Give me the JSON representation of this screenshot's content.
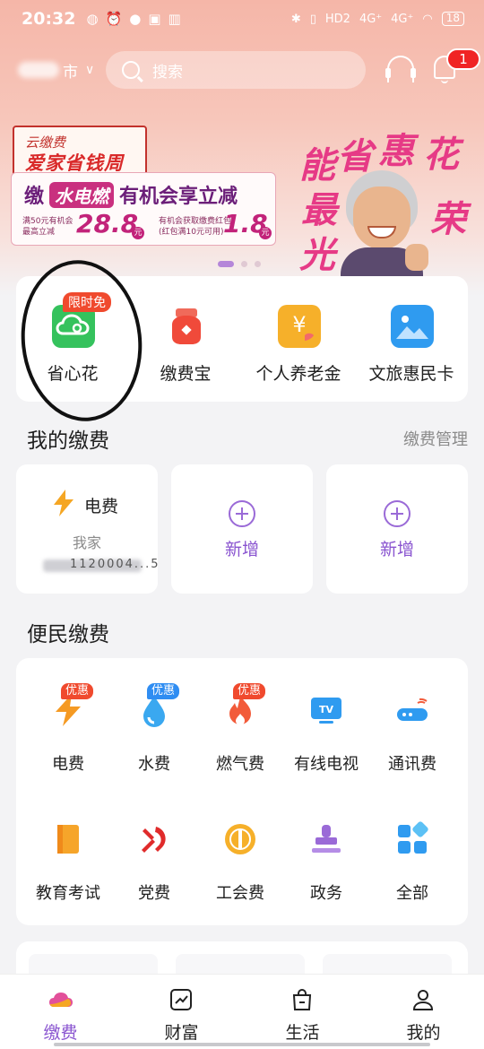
{
  "status_bar": {
    "time": "20:32",
    "network1": "HD2",
    "network2": "4G⁺",
    "network3": "4G⁺",
    "battery": "18"
  },
  "header": {
    "location_suffix": "市",
    "search_placeholder": "搜索",
    "notification_count": "1"
  },
  "banner": {
    "brand": "云缴费",
    "event_title": "爱家省钱周",
    "headline_prefix": "缴",
    "headline_pill": "水电燃",
    "headline_suffix": "有机会享立减",
    "left_small": "满50元有机会\n最高立减",
    "left_amount": "28.8",
    "unit": "元",
    "right_small": "有机会获取缴费红包\n(红包满10元可用)",
    "right_amount": "1.8",
    "slogan_chars": [
      "能",
      "省",
      "惠",
      "花",
      "最",
      "光",
      "荣"
    ]
  },
  "quick_actions": [
    {
      "label": "省心花",
      "badge": "限时免",
      "icon": "cloud-wallet-icon",
      "color": "#2fbf5a"
    },
    {
      "label": "缴费宝",
      "badge": "",
      "icon": "money-bag-icon",
      "color": "#f04a3a"
    },
    {
      "label": "个人养老金",
      "badge": "",
      "icon": "pension-icon",
      "color": "#f5a623"
    },
    {
      "label": "文旅惠民卡",
      "badge": "",
      "icon": "landscape-card-icon",
      "color": "#2f9bf0"
    }
  ],
  "my_payments": {
    "title": "我的缴费",
    "manage_link": "缴费管理",
    "cards": [
      {
        "type": "电费",
        "subtitle": "我家",
        "account_visible": "1120004...5"
      },
      {
        "add_label": "新增"
      },
      {
        "add_label": "新增"
      }
    ]
  },
  "convenience": {
    "title": "便民缴费",
    "items": [
      {
        "label": "电费",
        "badge": "优惠",
        "badge_color": "red",
        "icon": "electricity-icon"
      },
      {
        "label": "水费",
        "badge": "优惠",
        "badge_color": "blue",
        "icon": "water-drop-icon"
      },
      {
        "label": "燃气费",
        "badge": "优惠",
        "badge_color": "red",
        "icon": "gas-flame-icon"
      },
      {
        "label": "有线电视",
        "badge": "",
        "icon": "tv-icon"
      },
      {
        "label": "通讯费",
        "badge": "",
        "icon": "router-icon"
      },
      {
        "label": "教育考试",
        "badge": "",
        "icon": "book-icon"
      },
      {
        "label": "党费",
        "badge": "",
        "icon": "party-emblem-icon"
      },
      {
        "label": "工会费",
        "badge": "",
        "icon": "union-badge-icon"
      },
      {
        "label": "政务",
        "badge": "",
        "icon": "stamp-icon"
      },
      {
        "label": "全部",
        "badge": "",
        "icon": "grid-all-icon"
      }
    ]
  },
  "bottom_nav": [
    {
      "label": "缴费",
      "active": true,
      "icon": "cloud-pay-icon"
    },
    {
      "label": "财富",
      "active": false,
      "icon": "chart-icon"
    },
    {
      "label": "生活",
      "active": false,
      "icon": "shopping-bag-icon"
    },
    {
      "label": "我的",
      "active": false,
      "icon": "user-icon"
    }
  ],
  "colors": {
    "accent": "#8a55d0",
    "header_gradient_top": "#f5b6a8",
    "badge_red": "#f04a2e",
    "badge_blue": "#2f8df2"
  }
}
